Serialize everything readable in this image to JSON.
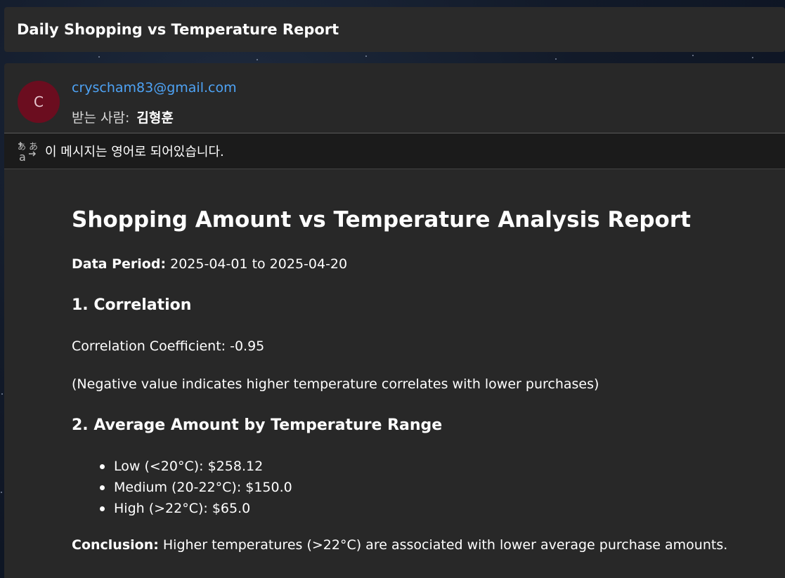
{
  "subject": "Daily Shopping vs Temperature Report",
  "sender": {
    "avatar_letter": "C",
    "avatar_color": "#6b0d1f",
    "email": "cryscham83@gmail.com",
    "recipient_label": "받는 사람:",
    "recipient_name": "김형훈"
  },
  "translate_bar": {
    "icon": "translate-icon",
    "message": "이 메시지는 영어로 되어있습니다."
  },
  "report": {
    "title": "Shopping Amount vs Temperature Analysis Report",
    "period_label": "Data Period:",
    "period_value": "2025-04-01 to 2025-04-20",
    "section1_heading": "1. Correlation",
    "correlation_line": "Correlation Coefficient: -0.95",
    "correlation_note": "(Negative value indicates higher temperature correlates with lower purchases)",
    "section2_heading": "2. Average Amount by Temperature Range",
    "ranges": [
      "Low (<20°C): $258.12",
      "Medium (20-22°C): $150.0",
      "High (>22°C): $65.0"
    ],
    "conclusion_label": "Conclusion:",
    "conclusion_text": "Higher temperatures (>22°C) are associated with lower average purchase amounts."
  },
  "colors": {
    "link": "#4ea3f5",
    "panel": "#282828",
    "subject_bar": "#2a2a2a"
  }
}
